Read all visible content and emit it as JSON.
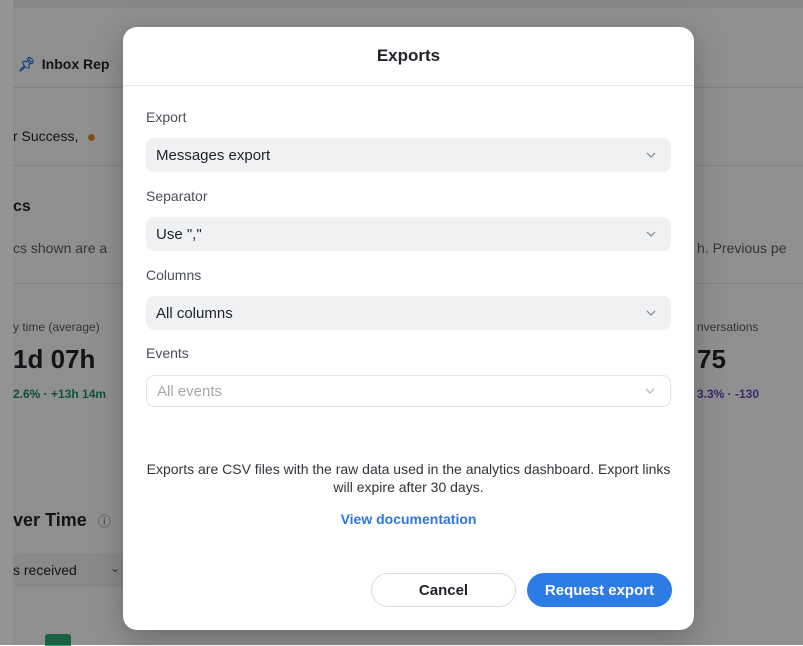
{
  "background": {
    "tab_label": "Inbox Rep",
    "filter_text": "r Success,",
    "section_title": "cs",
    "section_desc": "cs shown are a",
    "right_desc": "h. Previous pe",
    "metric_left_label": "y time (average)",
    "metric_left_value": "1d 07h",
    "metric_left_change": "2.6% · +13h 14m",
    "metric_right_label": "nversations",
    "metric_right_value": "75",
    "metric_right_change": "3.3% · -130",
    "chart_title": "ver Time",
    "chart_select": "s received"
  },
  "modal": {
    "title": "Exports",
    "fields": [
      {
        "label": "Export",
        "value": "Messages export"
      },
      {
        "label": "Separator",
        "value": "Use \",\""
      },
      {
        "label": "Columns",
        "value": "All columns"
      },
      {
        "label": "Events",
        "placeholder": "All events"
      }
    ],
    "info": "Exports are CSV files with the raw data used in the analytics dashboard. Export links will expire after 30 days.",
    "doc_link": "View documentation",
    "cancel_label": "Cancel",
    "submit_label": "Request export"
  },
  "colors": {
    "primary": "#2d7be5",
    "link": "#2d76e0",
    "positive": "#1a8a6e",
    "negative": "#6b3fb8"
  }
}
